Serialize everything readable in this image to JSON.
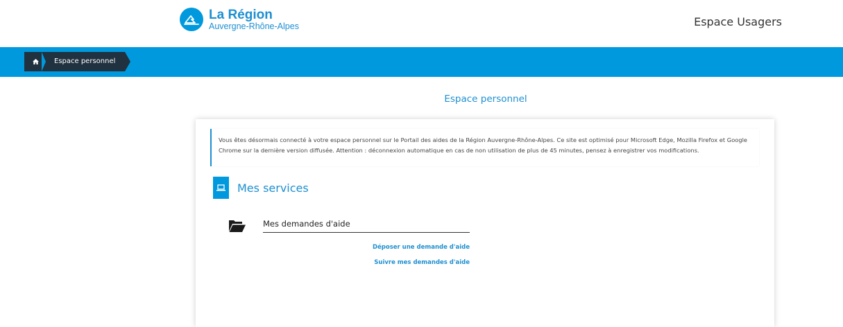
{
  "header": {
    "logo_title": "La Région",
    "logo_subtitle": "Auvergne-Rhône-Alpes",
    "right_title": "Espace Usagers"
  },
  "breadcrumb": {
    "home_icon": "home-icon",
    "current": "Espace personnel"
  },
  "page": {
    "heading": "Espace personnel"
  },
  "notice": {
    "text": "Vous êtes désormais connecté à votre espace personnel sur le Portail des aides de la Région Auvergne-Rhône-Alpes. Ce site est optimisé pour Microsoft Edge, Mozilla Firefox et Google Chrome sur la dernière version diffusée. Attention : déconnexion automatique en cas de non utilisation de plus de 45 minutes, pensez à enregistrer vos modifications."
  },
  "services": {
    "title": "Mes services",
    "icon": "laptop-icon",
    "demandes": {
      "icon": "folder-open-icon",
      "title": "Mes demandes d'aide",
      "links": [
        "Déposer une demande d'aide",
        "Suivre mes demandes d'aide"
      ]
    }
  },
  "colors": {
    "brand_blue": "#0099dd",
    "dark_crumb": "#20313f",
    "text_blue": "#1e8fd1"
  }
}
